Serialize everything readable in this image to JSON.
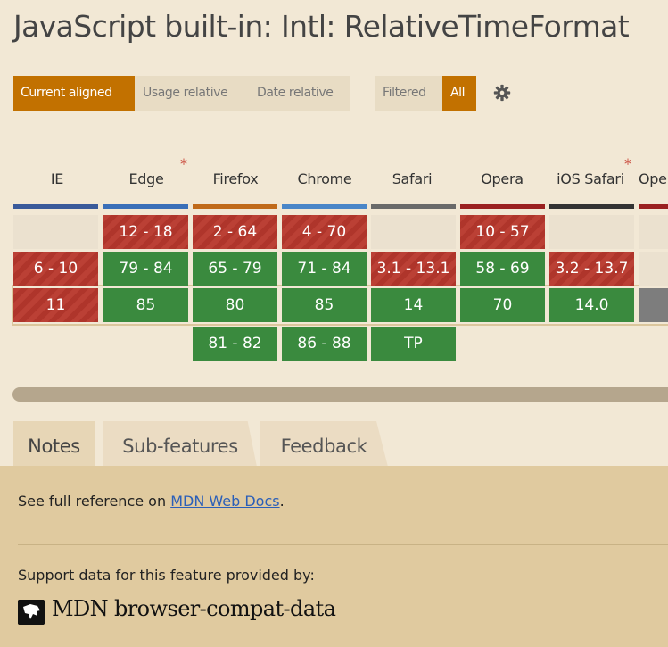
{
  "page": {
    "title": "JavaScript built-in: Intl: RelativeTimeFormat"
  },
  "toolbar": {
    "current_aligned": "Current aligned",
    "usage_relative": "Usage relative",
    "date_relative": "Date relative",
    "filtered": "Filtered",
    "all": "All",
    "settings_icon": "gear-icon"
  },
  "browsers": [
    {
      "name": "IE",
      "bar_color": "#3a5a9a",
      "note": ""
    },
    {
      "name": "Edge",
      "bar_color": "#3a6fb8",
      "note": "*"
    },
    {
      "name": "Firefox",
      "bar_color": "#c06a1a",
      "note": ""
    },
    {
      "name": "Chrome",
      "bar_color": "#4a86c8",
      "note": ""
    },
    {
      "name": "Safari",
      "bar_color": "#6a6a6a",
      "note": ""
    },
    {
      "name": "Opera",
      "bar_color": "#9a2020",
      "note": ""
    },
    {
      "name": "iOS Safari",
      "bar_color": "#333333",
      "note": "*"
    },
    {
      "name": "Ope",
      "bar_color": "#9a2020",
      "note": ""
    }
  ],
  "rows": {
    "past1": [
      "",
      "12 - 18",
      "2 - 64",
      "4 - 70",
      "",
      "10 - 57",
      "",
      ""
    ],
    "past2": [
      "6 - 10",
      "79 - 84",
      "65 - 79",
      "71 - 84",
      "3.1 - 13.1",
      "58 - 69",
      "3.2 - 13.7",
      ""
    ],
    "current": [
      "11",
      "85",
      "80",
      "85",
      "14",
      "70",
      "14.0",
      ""
    ],
    "future": [
      "",
      "",
      "81 - 82",
      "86 - 88",
      "TP",
      "",
      "",
      ""
    ]
  },
  "status_colors": {
    "supported": "#3a8a3e",
    "unsupported": "#b8382d",
    "unknown": "#7d7d7d"
  },
  "tabs": {
    "notes": "Notes",
    "sub_features": "Sub-features",
    "feedback": "Feedback"
  },
  "notes": {
    "prefix": "See full reference on ",
    "link": "MDN Web Docs",
    "suffix": ".",
    "support_label": "Support data for this feature provided by:",
    "mdn_source": "MDN browser-compat-data"
  }
}
